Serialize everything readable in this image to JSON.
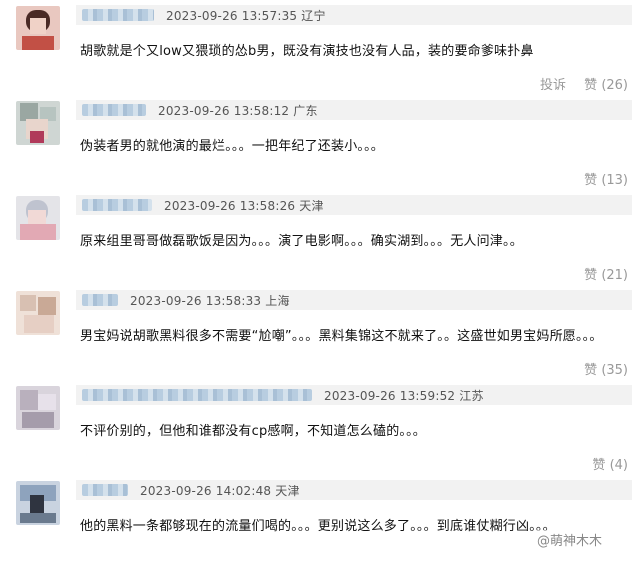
{
  "comments": [
    {
      "time": "2023-09-26 13:57:35",
      "location": "辽宁",
      "text": "胡歌就是个又low又猥琐的怂b男，既没有演技也没有人品，装的要命爹味扑鼻",
      "report_label": "投诉",
      "like_label": "赞",
      "like_count": "(26)"
    },
    {
      "time": "2023-09-26 13:58:12",
      "location": "广东",
      "text": "伪装者男的就他演的最烂。。。一把年纪了还装小。。。",
      "report_label": "",
      "like_label": "赞",
      "like_count": "(13)"
    },
    {
      "time": "2023-09-26 13:58:26",
      "location": "天津",
      "text": "原来组里哥哥做磊歌饭是因为。。。演了电影啊。。。确实湖到。。。无人问津。。",
      "report_label": "",
      "like_label": "赞",
      "like_count": "(21)"
    },
    {
      "time": "2023-09-26 13:58:33",
      "location": "上海",
      "text": "男宝妈说胡歌黑料很多不需要“尬嘲”。。。黑料集锦这不就来了。。这盛世如男宝妈所愿。。。",
      "report_label": "",
      "like_label": "赞",
      "like_count": "(35)"
    },
    {
      "time": "2023-09-26 13:59:52",
      "location": "江苏",
      "text": "不评价别的，但他和谁都没有cp感啊，不知道怎么磕的。。。",
      "report_label": "",
      "like_label": "赞",
      "like_count": "(4)"
    },
    {
      "time": "2023-09-26 14:02:48",
      "location": "天津",
      "text": "他的黑料一条都够现在的流量们喝的。。。更别说这么多了。。。到底谁仗糊行凶。。。",
      "report_label": "",
      "like_label": "",
      "like_count": ""
    }
  ],
  "watermark": "@萌神木木",
  "colors": {
    "header_bg": "#f2f2f2",
    "meta_text": "#555555",
    "action_text": "#999999"
  }
}
